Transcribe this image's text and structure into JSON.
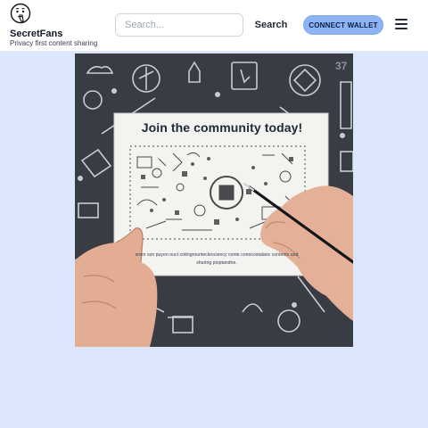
{
  "header": {
    "logo_icon": "shushing-face-icon",
    "brand_name": "SecretFans",
    "tagline": "Privacy first content sharing",
    "search": {
      "placeholder": "Search...",
      "value": ""
    },
    "search_button_label": "Search",
    "connect_button_label": "CONNECT WALLET",
    "menu_icon": "hamburger-menu-icon"
  },
  "hero": {
    "title": "Join the community today!",
    "caption": "srern ozn puyon ouct cottngrountecleociency conte conocostalanc contents and sharing ploptandne."
  },
  "colors": {
    "page_background": "#dce6fd",
    "accent_button": "#8db4f5",
    "hero_board": "#3f4249"
  }
}
